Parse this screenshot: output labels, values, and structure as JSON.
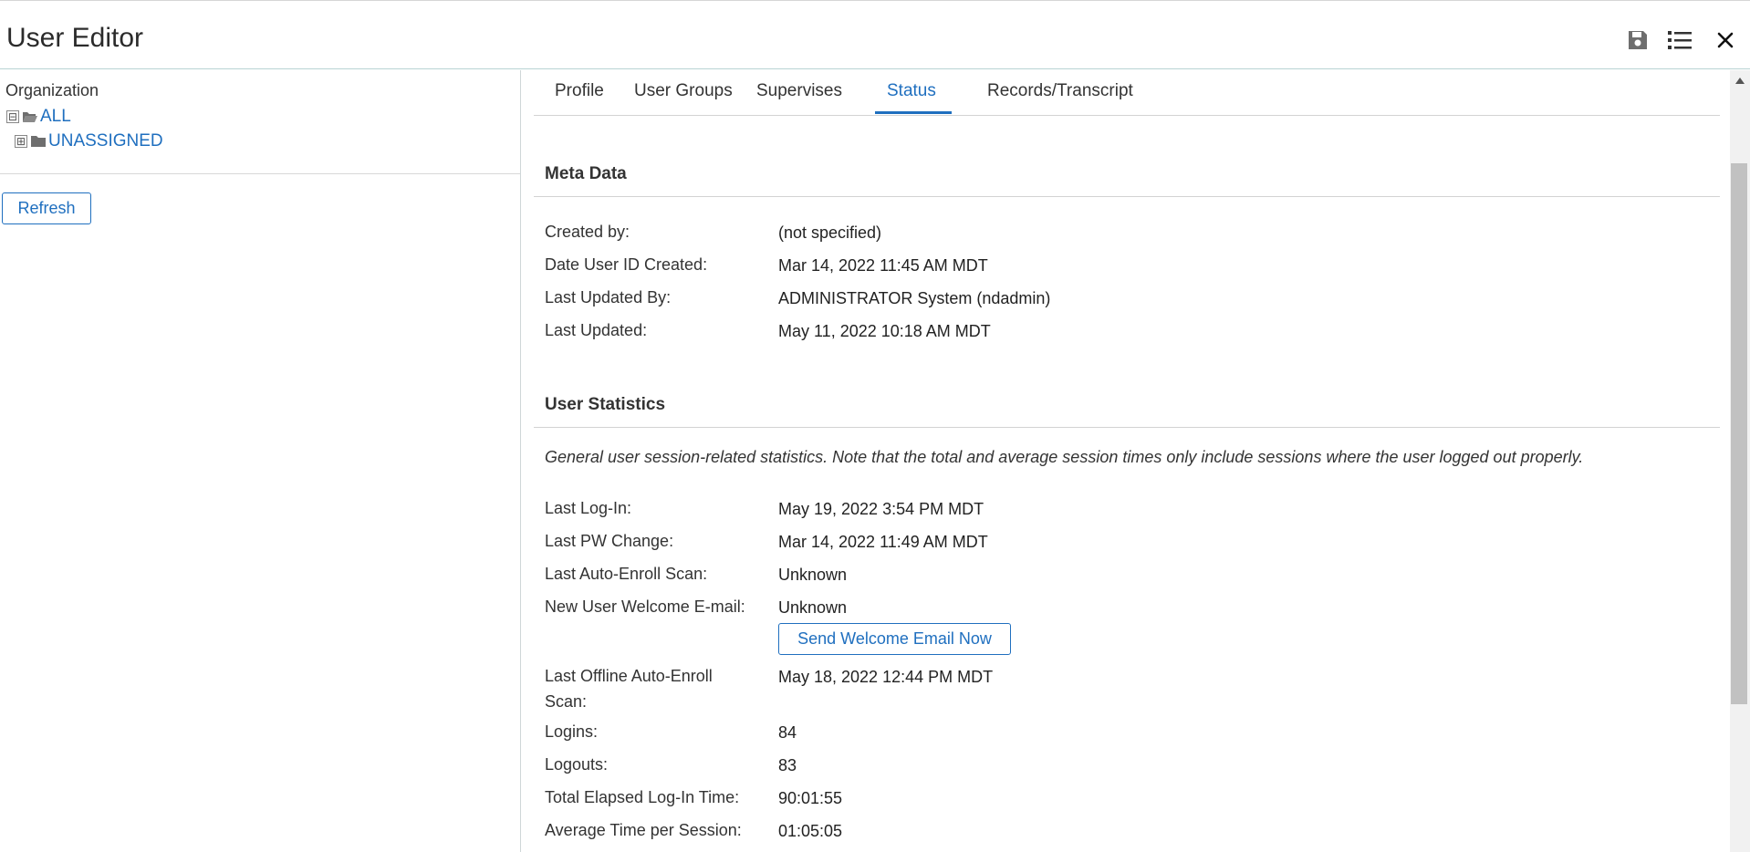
{
  "window": {
    "title": "User Editor",
    "icons": [
      "save-icon",
      "list-icon",
      "close-icon"
    ]
  },
  "sidebar": {
    "org_label": "Organization",
    "tree": [
      {
        "label": "ALL",
        "expander": "⊟",
        "icon": "folder-open-icon"
      },
      {
        "label": "UNASSIGNED",
        "expander": "⊞",
        "icon": "folder-icon"
      }
    ],
    "refresh_label": "Refresh"
  },
  "tabs": [
    {
      "label": "Profile",
      "active": false
    },
    {
      "label": "User Groups",
      "active": false
    },
    {
      "label": "Supervises",
      "active": false
    },
    {
      "label": "Status",
      "active": true
    },
    {
      "label": "Records/Transcript",
      "active": false
    }
  ],
  "meta": {
    "title": "Meta Data",
    "rows": [
      {
        "label": "Created by:",
        "value": "(not specified)"
      },
      {
        "label": "Date User ID Created:",
        "value": "Mar 14, 2022 11:45 AM MDT"
      },
      {
        "label": "Last Updated By:",
        "value": "ADMINISTRATOR System (ndadmin)"
      },
      {
        "label": "Last Updated:",
        "value": "May 11, 2022 10:18 AM MDT"
      }
    ]
  },
  "stats": {
    "title": "User Statistics",
    "note": "General user session-related statistics. Note that the total and average session times only include sessions where the user logged out properly.",
    "rows": [
      {
        "label": "Last Log-In:",
        "value": "May 19, 2022 3:54 PM MDT"
      },
      {
        "label": "Last PW Change:",
        "value": "Mar 14, 2022 11:49 AM MDT"
      },
      {
        "label": "Last Auto-Enroll Scan:",
        "value": "Unknown"
      },
      {
        "label": "New User Welcome E-mail:",
        "value": "Unknown"
      },
      {
        "label": "Last Offline Auto-Enroll Scan:",
        "value": "May 18, 2022 12:44 PM MDT"
      },
      {
        "label": "Logins:",
        "value": "84"
      },
      {
        "label": "Logouts:",
        "value": "83"
      },
      {
        "label": "Total Elapsed Log-In Time:",
        "value": "90:01:55"
      },
      {
        "label": "Average Time per Session:",
        "value": "01:05:05"
      }
    ],
    "welcome_button": "Send Welcome Email Now"
  },
  "colors": {
    "accent": "#1f6fbf",
    "header_border": "#b9d3d3"
  }
}
